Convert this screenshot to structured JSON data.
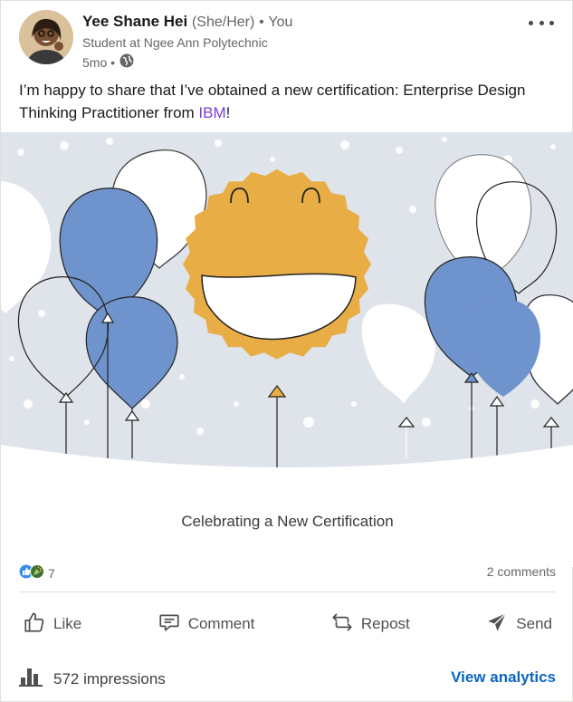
{
  "author": {
    "name": "Yee Shane Hei",
    "pronouns": "(She/Her)",
    "separator": "•",
    "relation": "You",
    "headline": "Student at Ngee Ann Polytechnic",
    "time": "5mo •",
    "visibility_icon": "globe-icon"
  },
  "post": {
    "text_before": "I’m happy to share that I’ve obtained a new certification: Enterprise Design Thinking Practitioner from ",
    "mention": "IBM",
    "text_after": "!"
  },
  "media": {
    "caption": "Celebrating a New Certification",
    "colors": {
      "background": "#dfe3ea",
      "balloon_blue": "#6f93cc",
      "sun": "#e8ae45"
    }
  },
  "social": {
    "reaction_count": "7",
    "comments": "2 comments",
    "reaction_icons": [
      "like-icon",
      "celebrate-icon"
    ]
  },
  "actions": {
    "like": "Like",
    "comment": "Comment",
    "repost": "Repost",
    "send": "Send"
  },
  "footer": {
    "impressions": "572 impressions",
    "view_analytics": "View analytics"
  }
}
